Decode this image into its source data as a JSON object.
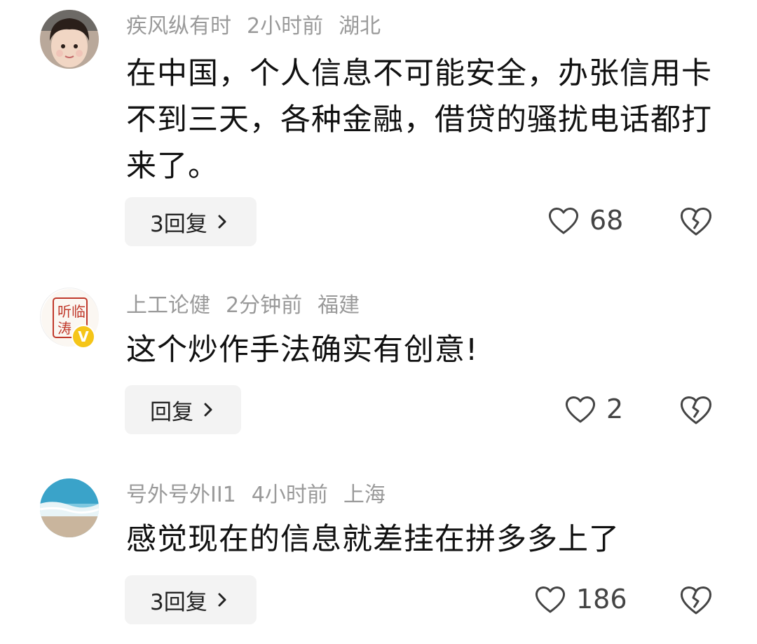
{
  "comments": [
    {
      "username": "疾风纵有时",
      "time": "2小时前",
      "location": "湖北",
      "text": "在中国，个人信息不可能安全，办张信用卡不到三天，各种金融，借贷的骚扰电话都打来了。",
      "reply_label": "3回复",
      "likes": "68"
    },
    {
      "username": "上工论健",
      "time": "2分钟前",
      "location": "福建",
      "text": "这个炒作手法确实有创意!",
      "reply_label": "回复",
      "likes": "2",
      "avatar_seal_text": "听临涛",
      "verified_badge": "V"
    },
    {
      "username": "号外号外II1",
      "time": "4小时前",
      "location": "上海",
      "text": "感觉现在的信息就差挂在拼多多上了",
      "reply_label": "3回复",
      "likes": "186"
    }
  ],
  "icons": {
    "like": "heart-outline-icon",
    "dislike": "broken-heart-icon",
    "reply_chevron": "chevron-right-icon"
  },
  "colors": {
    "meta_text": "#9a9a9a",
    "reply_bg": "#f3f3f3",
    "verified_badge": "#f5c518",
    "seal_red": "#c0392b"
  }
}
